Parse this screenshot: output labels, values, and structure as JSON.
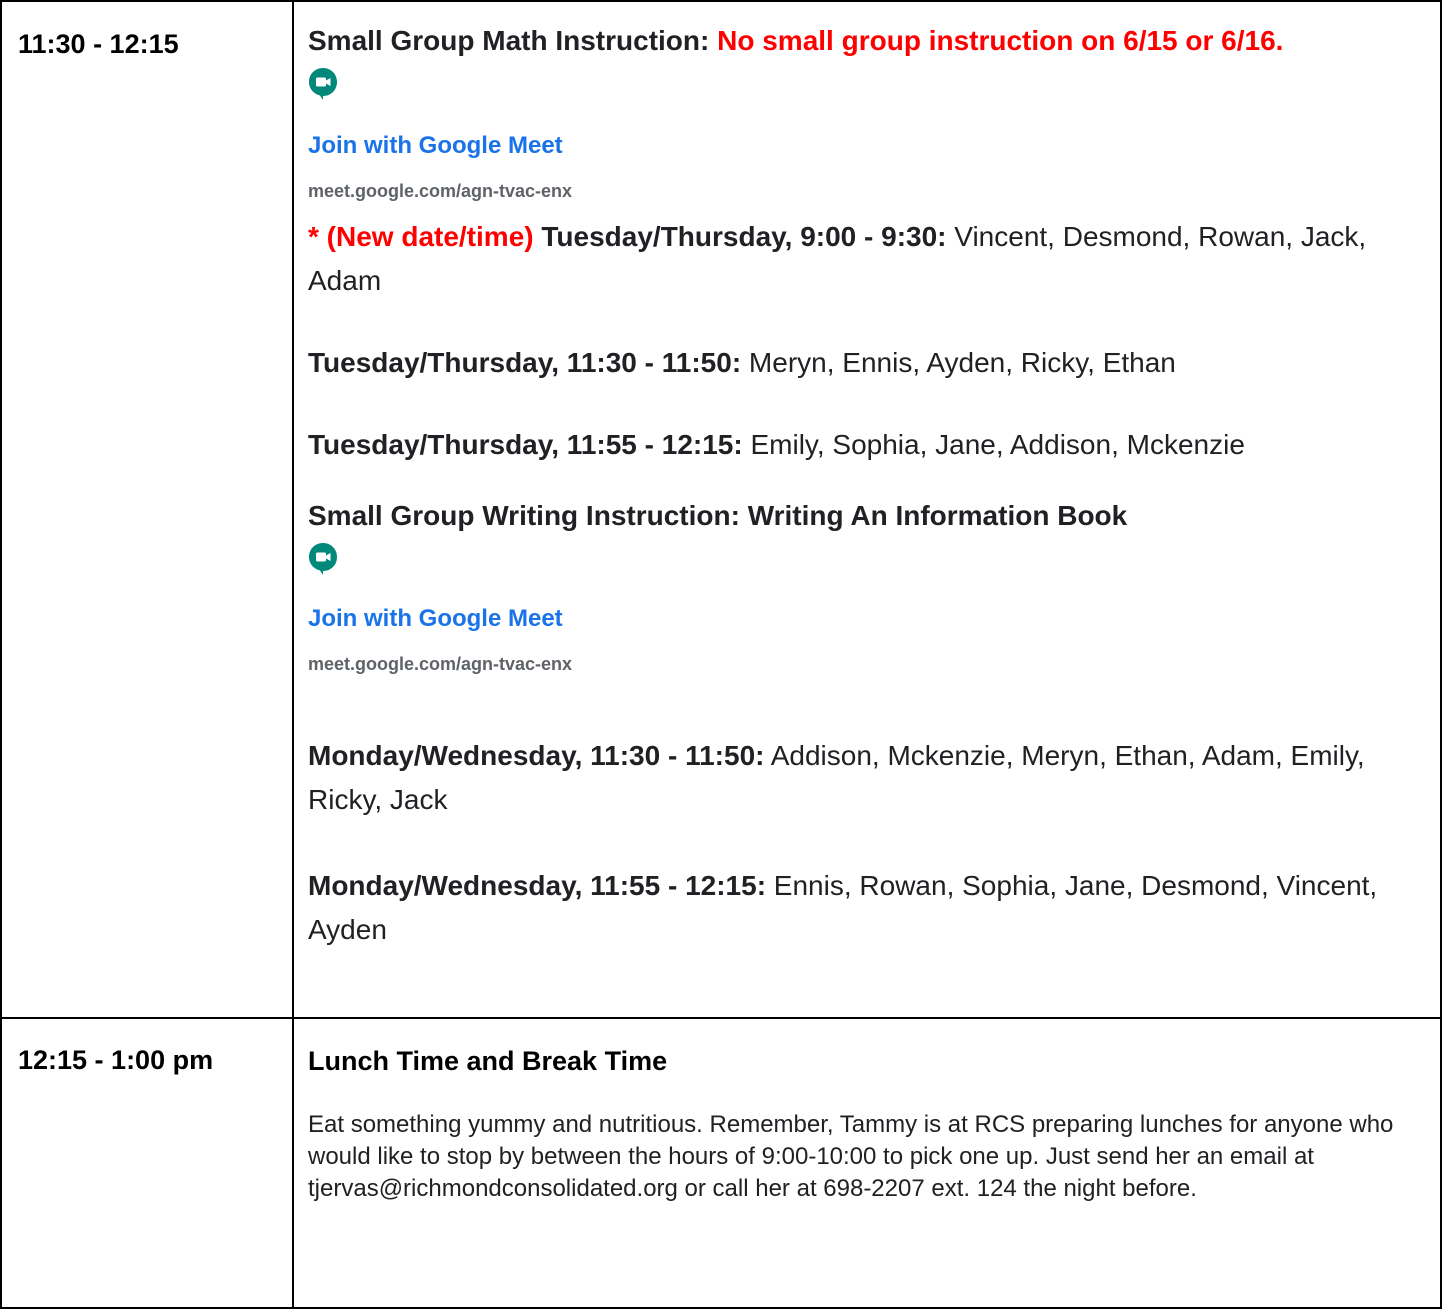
{
  "rows": [
    {
      "time": "11:30 - 12:15",
      "math": {
        "title": "Small Group Math Instruction: ",
        "notice": "No small group instruction on 6/15 or 6/16.",
        "meet_icon": "google-meet-icon",
        "join_label": "Join with Google Meet",
        "url": "meet.google.com/agn-tvac-enx",
        "groups": [
          {
            "prefix": "* (New date/time) ",
            "days": "Tuesday/Thursday, 9:00 - 9:30:",
            "students": " Vincent, Desmond, Rowan, Jack, Adam"
          },
          {
            "days": "Tuesday/Thursday, 11:30 - 11:50:",
            "students": " Meryn, Ennis, Ayden, Ricky, Ethan"
          },
          {
            "days": "Tuesday/Thursday, 11:55 - 12:15:",
            "students": " Emily, Sophia, Jane, Addison, Mckenzie"
          }
        ]
      },
      "writing": {
        "title": "Small Group Writing Instruction: Writing An Information Book",
        "meet_icon": "google-meet-icon",
        "join_label": "Join with Google Meet",
        "url": "meet.google.com/agn-tvac-enx",
        "groups": [
          {
            "days": "Monday/Wednesday, 11:30 - 11:50:",
            "students": " Addison, Mckenzie, Meryn, Ethan, Adam, Emily, Ricky, Jack"
          },
          {
            "days": "Monday/Wednesday, 11:55 - 12:15:",
            "students": " Ennis, Rowan, Sophia, Jane, Desmond, Vincent, Ayden"
          }
        ]
      }
    },
    {
      "time": "12:15 - 1:00 pm",
      "title": "Lunch Time and Break Time",
      "body": "Eat something yummy and nutritious. Remember, Tammy is at RCS preparing lunches for anyone who would like to stop by between the hours of 9:00-10:00 to pick one up. Just send her an email at tjervas@richmondconsolidated.org or call her at 698-2207 ext. 124 the night before."
    }
  ],
  "colors": {
    "link": "#1a73e8",
    "alert": "#ff0000",
    "meet_icon": "#00897b"
  }
}
